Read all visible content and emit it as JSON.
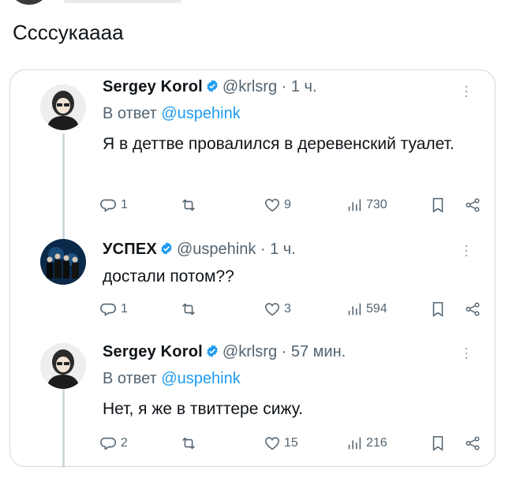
{
  "caption": "Ссссукаааа",
  "colors": {
    "link": "#1d9bf0",
    "verified": "#1d9bf0",
    "secondary": "#536471",
    "border": "#cfd9de"
  },
  "tweets": [
    {
      "name": "Sergey Korol",
      "handle": "@krlsrg",
      "time": "· 1 ч.",
      "reply_prefix": "В ответ",
      "reply_mention": "@uspehink",
      "text": "Я в деттве провалился в деревенский туалет.",
      "replies": "1",
      "retweets": "",
      "likes": "9",
      "views": "730",
      "avatar_icon": "person-avatar-icon"
    },
    {
      "name": "УСПЕХ",
      "handle": "@uspehink",
      "time": "· 1 ч.",
      "text": "достали потом??",
      "replies": "1",
      "retweets": "",
      "likes": "3",
      "views": "594",
      "avatar_icon": "band-photo-avatar-icon"
    },
    {
      "name": "Sergey Korol",
      "handle": "@krlsrg",
      "time": "· 57 мин.",
      "reply_prefix": "В ответ",
      "reply_mention": "@uspehink",
      "text": "Нет, я же в твиттере сижу.",
      "replies": "2",
      "retweets": "",
      "likes": "15",
      "views": "216",
      "avatar_icon": "person-avatar-icon"
    }
  ]
}
